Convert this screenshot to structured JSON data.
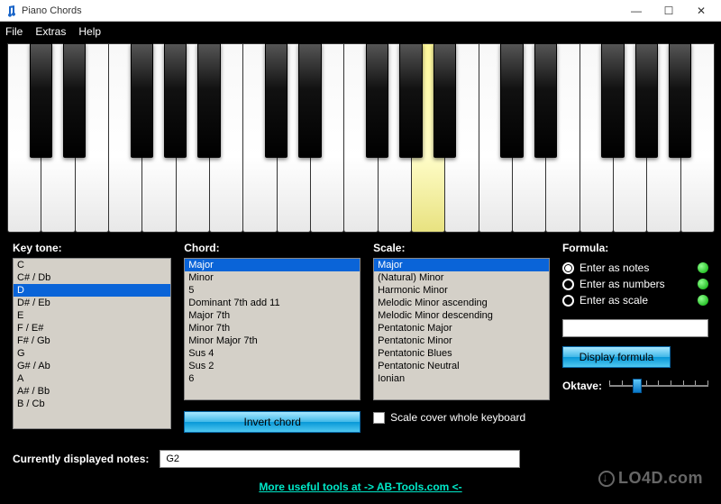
{
  "window": {
    "title": "Piano Chords"
  },
  "menu": {
    "items": [
      "File",
      "Extras",
      "Help"
    ]
  },
  "piano": {
    "white_key_count": 21,
    "highlight_index": 12,
    "black_key_pattern": [
      true,
      true,
      false,
      true,
      true,
      true,
      false,
      true,
      true,
      false,
      true,
      true,
      true,
      false,
      true,
      true,
      false,
      true,
      true,
      true,
      false
    ]
  },
  "labels": {
    "key_tone": "Key tone:",
    "chord": "Chord:",
    "scale": "Scale:",
    "formula": "Formula:",
    "oktave": "Oktave:",
    "currently_displayed": "Currently displayed notes:"
  },
  "key_tone": {
    "items": [
      "C",
      "C# / Db",
      "D",
      "D# / Eb",
      "E",
      "F / E#",
      "F# / Gb",
      "G",
      "G# / Ab",
      "A",
      "A# / Bb",
      "B / Cb"
    ],
    "selected_index": 2
  },
  "chord": {
    "items": [
      "Major",
      "Minor",
      "5",
      "Dominant 7th add 11",
      "Major 7th",
      "Minor 7th",
      "Minor Major 7th",
      "Sus 4",
      "Sus 2",
      "6"
    ],
    "selected_index": 0,
    "invert_label": "Invert chord"
  },
  "scale": {
    "items": [
      "Major",
      "(Natural) Minor",
      "Harmonic Minor",
      "Melodic Minor ascending",
      "Melodic Minor descending",
      "Pentatonic Major",
      "Pentatonic Minor",
      "Pentatonic Blues",
      "Pentatonic Neutral",
      "Ionian"
    ],
    "selected_index": 0,
    "checkbox_label": "Scale cover whole keyboard"
  },
  "formula": {
    "options": [
      "Enter as notes",
      "Enter as numbers",
      "Enter as scale"
    ],
    "selected_index": 0,
    "input_value": "",
    "display_label": "Display formula"
  },
  "notes": {
    "value": "G2"
  },
  "footer": {
    "link": "More useful tools at -> AB-Tools.com <-"
  },
  "watermark": "LO4D.com"
}
